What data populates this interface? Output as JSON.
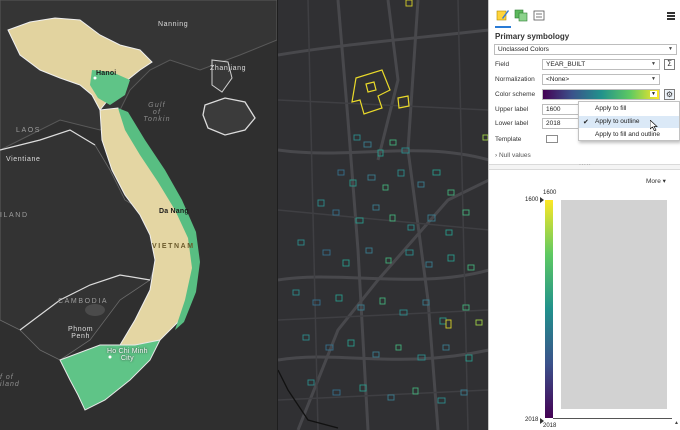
{
  "left_map": {
    "labels": {
      "nanning": "Nanning",
      "hanoi": "Hanoi",
      "zhanjiang": "Zhanjiang",
      "gulf_line1": "Gulf",
      "gulf_line2": "of",
      "gulf_line3": "Tonkin",
      "laos": "LAOS",
      "vientiane": "Vientiane",
      "thailand_fragment": "ILAND",
      "da_nang": "Da Nang",
      "vietnam": "VIETNAM",
      "cambodia": "CAMBODIA",
      "phnom_penh_line1": "Phnom",
      "phnom_penh_line2": "Penh",
      "hcmc_line1": "Ho Chi Minh",
      "hcmc_line2": "City",
      "gulf_thailand_line1": "f of",
      "gulf_thailand_line2": "iland"
    },
    "colors": {
      "land": "#e6d7a4",
      "lowland": "#5fc487",
      "background": "#2f2f2f",
      "borders": "#d8d8d8"
    }
  },
  "right_map": {
    "colors": {
      "background": "#303033",
      "roads": "#4a4a4e",
      "highlight": "#f2e02c"
    }
  },
  "pane": {
    "tabs": [
      {
        "icon": "paintbrush-icon",
        "selected": true
      },
      {
        "icon": "layers-symbol-icon",
        "selected": false
      },
      {
        "icon": "properties-icon",
        "selected": false
      }
    ],
    "menu_icon": "hamburger-icon",
    "section_title": "Primary symbology",
    "symbology_method": "Unclassed Colors",
    "field_label": "Field",
    "field_value": "YEAR_BUILT",
    "normalization_label": "Normalization",
    "normalization_value": "<None>",
    "color_scheme_label": "Color scheme",
    "color_scheme_icon": "gear-icon",
    "upper_label_label": "Upper label",
    "upper_label_value": "1600",
    "lower_label_label": "Lower label",
    "lower_label_value": "2018",
    "template_label": "Template",
    "null_values_label": "Null values",
    "more_label": "More",
    "legend": {
      "top_label": "1600",
      "handle_top_value": "1600",
      "handle_bottom_value": "2018",
      "bottom_label": "2018"
    }
  },
  "context_menu": {
    "items": [
      {
        "label": "Apply to fill",
        "checked": false,
        "hover": false
      },
      {
        "label": "Apply to outline",
        "checked": true,
        "hover": true
      },
      {
        "label": "Apply to fill and outline",
        "checked": false,
        "hover": false
      }
    ],
    "check_glyph": "✔"
  }
}
